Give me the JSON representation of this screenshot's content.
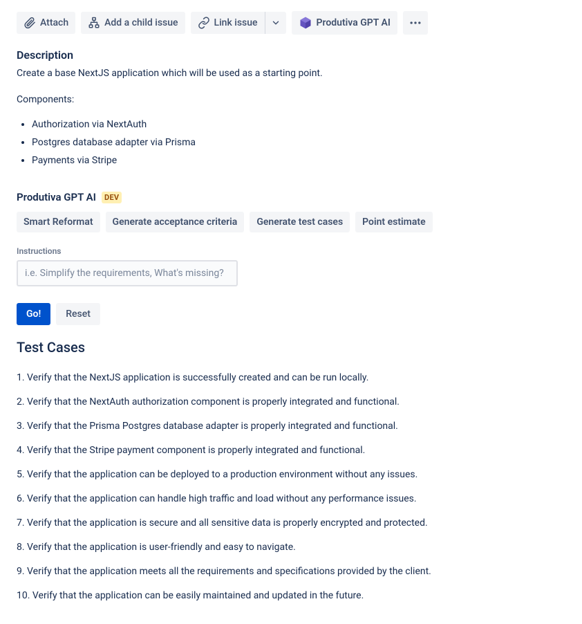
{
  "toolbar": {
    "attach": "Attach",
    "addChild": "Add a child issue",
    "link": "Link issue",
    "ai": "Produtiva GPT AI"
  },
  "description": {
    "title": "Description",
    "intro": "Create a base NextJS application which will be used as a starting point.",
    "componentsLabel": "Components:",
    "components": [
      "Authorization via NextAuth",
      "Postgres database adapter via Prisma",
      "Payments via Stripe"
    ]
  },
  "aiSection": {
    "name": "Produtiva GPT AI",
    "badge": "DEV",
    "actions": [
      "Smart Reformat",
      "Generate acceptance criteria",
      "Generate test cases",
      "Point estimate"
    ],
    "instructionsLabel": "Instructions",
    "placeholder": "i.e. Simplify the requirements, What's missing?",
    "go": "Go!",
    "reset": "Reset"
  },
  "testCases": {
    "title": "Test Cases",
    "items": [
      "Verify that the NextJS application is successfully created and can be run locally.",
      "Verify that the NextAuth authorization component is properly integrated and functional.",
      "Verify that the Prisma Postgres database adapter is properly integrated and functional.",
      "Verify that the Stripe payment component is properly integrated and functional.",
      "Verify that the application can be deployed to a production environment without any issues.",
      "Verify that the application can handle high traffic and load without any performance issues.",
      "Verify that the application is secure and all sensitive data is properly encrypted and protected.",
      "Verify that the application is user-friendly and easy to navigate.",
      "Verify that the application meets all the requirements and specifications provided by the client.",
      "Verify that the application can be easily maintained and updated in the future."
    ]
  }
}
